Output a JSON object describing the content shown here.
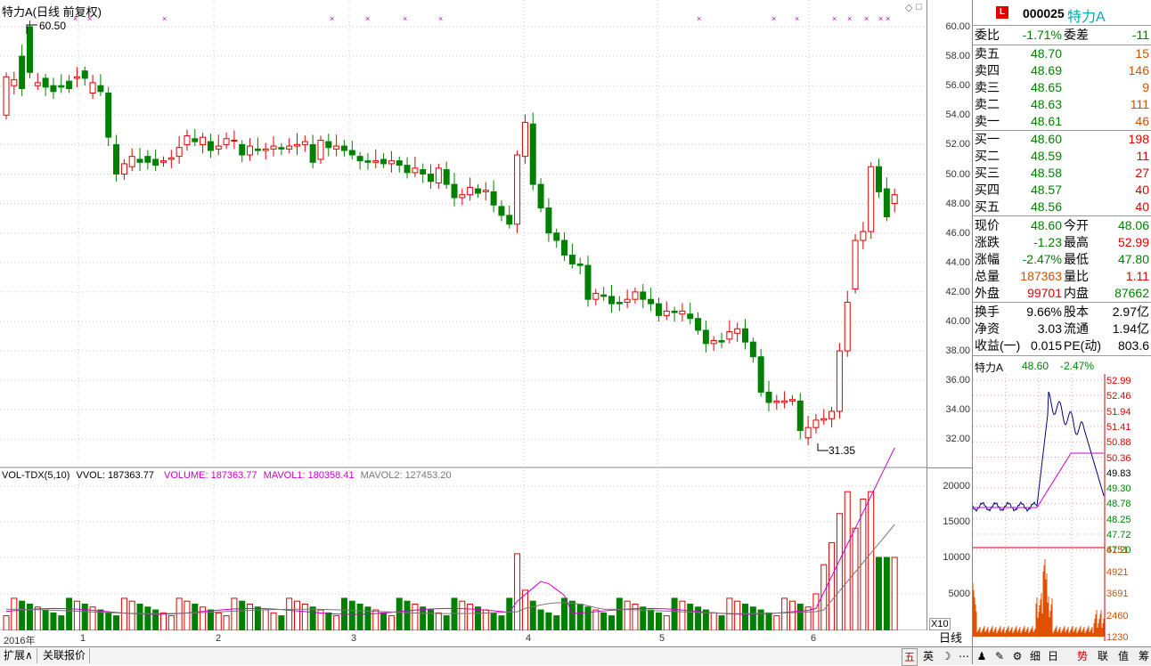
{
  "chart_header": {
    "title": "特力A(日线 前复权)",
    "max_label": "60.50",
    "min_label": "31.35"
  },
  "price_axis": [
    "60.00",
    "58.00",
    "56.00",
    "54.00",
    "52.00",
    "50.00",
    "48.00",
    "46.00",
    "44.00",
    "42.00",
    "40.00",
    "38.00",
    "36.00",
    "34.00",
    "32.00"
  ],
  "vol_header": {
    "name": "VOL-TDX(5,10)",
    "vvol": "VVOL: 187363.77",
    "volume": "VOLUME: 187363.77",
    "mavol1": "MAVOL1: 180358.41",
    "mavol2": "MAVOL2: 127453.20"
  },
  "vol_axis": [
    "20000",
    "15000",
    "10000",
    "5000"
  ],
  "vol_axis_unit": "X10",
  "x_axis": [
    "2016年",
    "1",
    "2",
    "3",
    "4",
    "5",
    "6"
  ],
  "period_label": "日线",
  "bottom_tabs": [
    "扩展∧",
    "关联报价"
  ],
  "toolbar_buttons": [
    "五",
    "英",
    "☽",
    "⋯",
    "♟",
    "✎",
    "⚙",
    "细",
    "日",
    "势",
    "联",
    "值",
    "筹"
  ],
  "colors": {
    "up": "#e00000",
    "down": "#008000",
    "mavol1": "#cc00cc",
    "mavol2": "#888888",
    "ma_line": "#cc00cc"
  },
  "quote": {
    "logo": "L",
    "code": "000025",
    "name": "特力A",
    "weibi_label": "委比",
    "weibi": "-1.71%",
    "weicha_label": "委差",
    "weicha": "-11",
    "asks": [
      {
        "label": "卖五",
        "price": "48.70",
        "vol": "15"
      },
      {
        "label": "卖四",
        "price": "48.69",
        "vol": "146"
      },
      {
        "label": "卖三",
        "price": "48.65",
        "vol": "9"
      },
      {
        "label": "卖二",
        "price": "48.63",
        "vol": "111"
      },
      {
        "label": "卖一",
        "price": "48.61",
        "vol": "46"
      }
    ],
    "bids": [
      {
        "label": "买一",
        "price": "48.60",
        "vol": "198"
      },
      {
        "label": "买二",
        "price": "48.59",
        "vol": "11"
      },
      {
        "label": "买三",
        "price": "48.58",
        "vol": "27"
      },
      {
        "label": "买四",
        "price": "48.57",
        "vol": "40"
      },
      {
        "label": "买五",
        "price": "48.56",
        "vol": "40"
      }
    ],
    "stats": [
      {
        "l1": "现价",
        "v1": "48.60",
        "c1": "green",
        "l2": "今开",
        "v2": "48.06",
        "c2": "green"
      },
      {
        "l1": "涨跌",
        "v1": "-1.23",
        "c1": "green",
        "l2": "最高",
        "v2": "52.99",
        "c2": "red"
      },
      {
        "l1": "涨幅",
        "v1": "-2.47%",
        "c1": "green",
        "l2": "最低",
        "v2": "47.80",
        "c2": "green"
      },
      {
        "l1": "总量",
        "v1": "187363",
        "c1": "orange",
        "l2": "量比",
        "v2": "1.11",
        "c2": "red"
      },
      {
        "l1": "外盘",
        "v1": "99701",
        "c1": "red",
        "l2": "内盘",
        "v2": "87662",
        "c2": "green"
      }
    ],
    "fundamentals": [
      {
        "l1": "换手",
        "v1": "9.66%",
        "l2": "股本",
        "v2": "2.97亿"
      },
      {
        "l1": "净资",
        "v1": "3.03",
        "l2": "流通",
        "v2": "1.94亿"
      },
      {
        "l1": "收益(一)",
        "v1": "0.015",
        "l2": "PE(动)",
        "v2": "803.6"
      }
    ]
  },
  "intraday": {
    "title": "特力A",
    "price": "48.60",
    "change": "-2.47%",
    "price_axis": [
      {
        "v": "52.99",
        "c": "red"
      },
      {
        "v": "52.46",
        "c": "red"
      },
      {
        "v": "51.94",
        "c": "red"
      },
      {
        "v": "51.41",
        "c": "red"
      },
      {
        "v": "50.88",
        "c": "red"
      },
      {
        "v": "50.36",
        "c": "red"
      },
      {
        "v": "49.83",
        "c": "black"
      },
      {
        "v": "49.30",
        "c": "green"
      },
      {
        "v": "48.78",
        "c": "green"
      },
      {
        "v": "48.25",
        "c": "green"
      },
      {
        "v": "47.72",
        "c": "green"
      },
      {
        "v": "47.20",
        "c": "green"
      }
    ],
    "vol_axis": [
      "6151",
      "4921",
      "3691",
      "2460",
      "1230"
    ]
  }
}
